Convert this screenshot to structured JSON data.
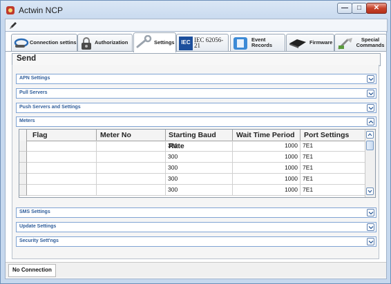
{
  "window": {
    "title": "Actwin NCP"
  },
  "tabs": [
    {
      "label": "Connection settins",
      "icon": "connection-icon",
      "active": false
    },
    {
      "label": "Authorization",
      "icon": "lock-icon",
      "active": false
    },
    {
      "label": "Settings",
      "icon": "wrench-icon",
      "active": true
    },
    {
      "label": "IEC 62056-21",
      "icon": "iec-icon",
      "active": false
    },
    {
      "label": "Event Records",
      "icon": "document-icon",
      "active": false
    },
    {
      "label": "Firmware",
      "icon": "chip-icon",
      "active": false
    },
    {
      "label": "Special Commands",
      "icon": "tools-icon",
      "active": false
    }
  ],
  "page": {
    "title": "Send"
  },
  "sections": {
    "apn": "APN Settings",
    "pull": "Pull Servers",
    "push": "Push Servers and Settings",
    "meters": "Meters",
    "sms": "SMS Settings",
    "update": "Update Settings",
    "security": "Security Sett'ngs"
  },
  "meters_table": {
    "columns": [
      "Flag",
      "Meter No",
      "Starting Baud Rate",
      "Wait Time Period",
      "Port Settings"
    ],
    "rows": [
      [
        "",
        "",
        "300",
        "1000",
        "7E1"
      ],
      [
        "",
        "",
        "300",
        "1000",
        "7E1"
      ],
      [
        "",
        "",
        "300",
        "1000",
        "7E1"
      ],
      [
        "",
        "",
        "300",
        "1000",
        "7E1"
      ],
      [
        "",
        "",
        "300",
        "1000",
        "7E1"
      ]
    ]
  },
  "status": {
    "connection": "No Connection"
  },
  "colors": {
    "section_text": "#2f5d9a",
    "section_border": "#7fa3d3",
    "window_frame": "#c6d8ee"
  }
}
